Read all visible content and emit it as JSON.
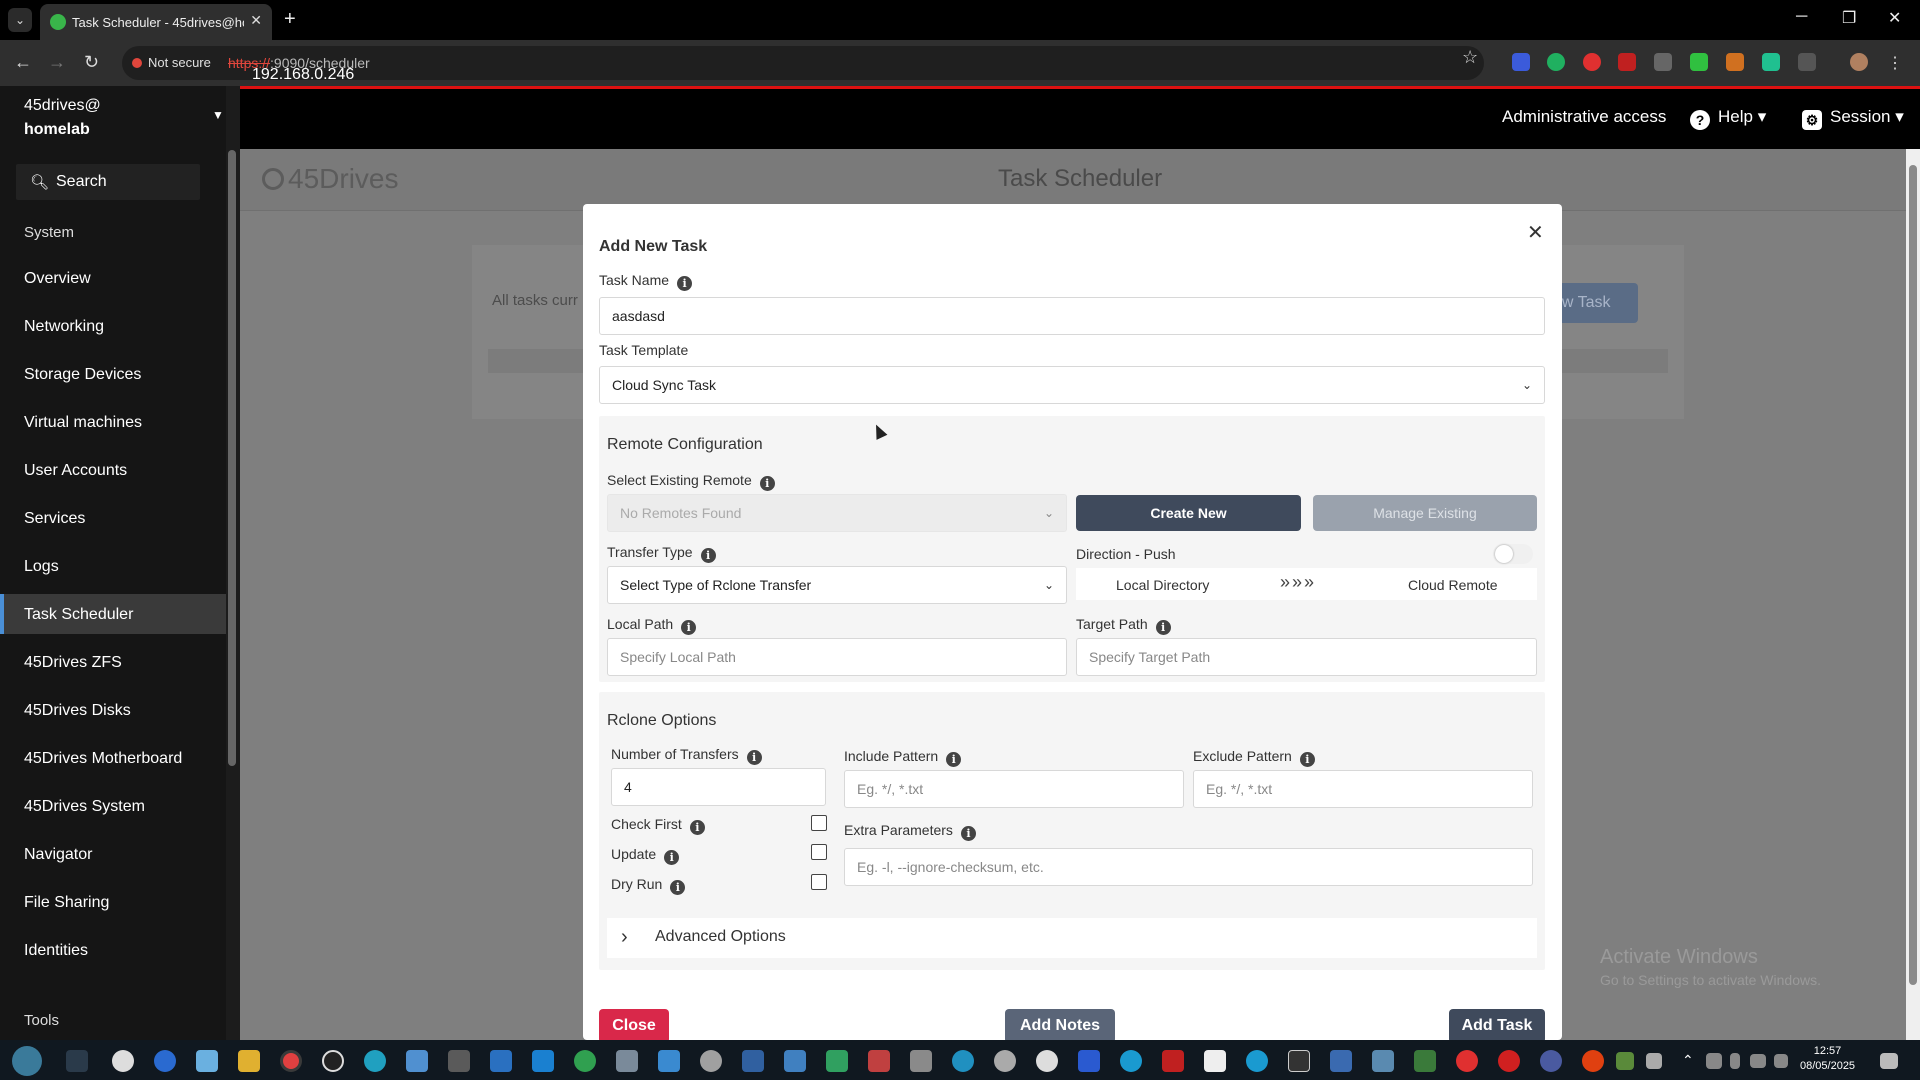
{
  "browser": {
    "tab_title": "Task Scheduler - 45drives@hom",
    "not_secure": "Not secure",
    "url_scheme": "https://",
    "url_host": "192.168.0.246",
    "url_rest": ":9090/scheduler"
  },
  "header": {
    "admin": "Administrative access",
    "help": "Help",
    "session": "Session"
  },
  "sidebar": {
    "host_user": "45drives@",
    "host_name": "homelab",
    "search_placeholder": "Search",
    "section_system": "System",
    "items": [
      {
        "label": "Overview"
      },
      {
        "label": "Networking"
      },
      {
        "label": "Storage Devices"
      },
      {
        "label": "Virtual machines"
      },
      {
        "label": "User Accounts"
      },
      {
        "label": "Services"
      },
      {
        "label": "Logs"
      },
      {
        "label": "Task Scheduler"
      },
      {
        "label": "45Drives ZFS"
      },
      {
        "label": "45Drives Disks"
      },
      {
        "label": "45Drives Motherboard"
      },
      {
        "label": "45Drives System"
      },
      {
        "label": "Navigator"
      },
      {
        "label": "File Sharing"
      },
      {
        "label": "Identities"
      }
    ],
    "section_tools": "Tools",
    "active": "Task Scheduler"
  },
  "page": {
    "logo": "45Drives",
    "title": "Task Scheduler",
    "empty_text": "All tasks curr",
    "new_task_button": "New Task"
  },
  "modal": {
    "title": "Add New Task",
    "task_name_label": "Task Name",
    "task_name_value": "aasdasd",
    "task_template_label": "Task Template",
    "task_template_value": "Cloud Sync Task",
    "remote_config_title": "Remote Configuration",
    "select_remote_label": "Select Existing Remote",
    "select_remote_value": "No Remotes Found",
    "create_new": "Create New",
    "manage_existing": "Manage Existing",
    "transfer_type_label": "Transfer Type",
    "transfer_type_value": "Select Type of Rclone Transfer",
    "direction_label": "Direction - Push",
    "direction_from": "Local Directory",
    "direction_to": "Cloud Remote",
    "local_path_label": "Local Path",
    "local_path_placeholder": "Specify Local Path",
    "target_path_label": "Target Path",
    "target_path_placeholder": "Specify Target Path",
    "rclone_title": "Rclone Options",
    "num_transfers_label": "Number of Transfers",
    "num_transfers_value": "4",
    "include_label": "Include Pattern",
    "include_placeholder": "Eg. */, *.txt",
    "exclude_label": "Exclude Pattern",
    "exclude_placeholder": "Eg. */, *.txt",
    "check_first": "Check First",
    "update": "Update",
    "dry_run": "Dry Run",
    "extra_label": "Extra Parameters",
    "extra_placeholder": "Eg. -l, --ignore-checksum, etc.",
    "advanced": "Advanced Options",
    "close": "Close",
    "add_notes": "Add Notes",
    "add_task": "Add Task"
  },
  "watermark": {
    "line1": "Activate Windows",
    "line2": "Go to Settings to activate Windows."
  },
  "clock": {
    "time": "12:57",
    "date": "08/05/2025"
  },
  "colors": {
    "accent": "#3f4a5c",
    "danger": "#d9284a",
    "active_border": "#4a8fd6"
  }
}
